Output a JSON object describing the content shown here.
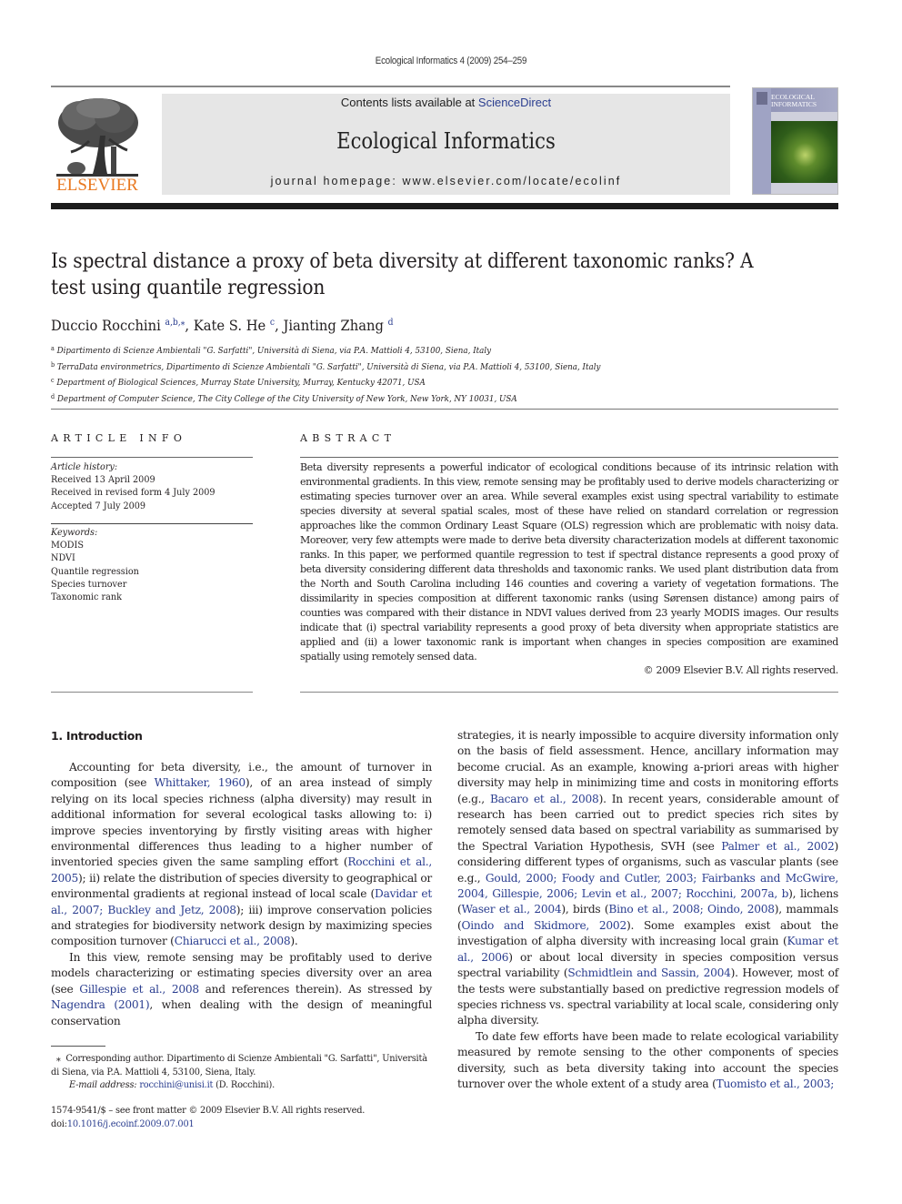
{
  "running_head": "Ecological Informatics 4 (2009) 254–259",
  "masthead": {
    "publisher": "ELSEVIER",
    "contents_prefix": "Contents lists available at ",
    "contents_link": "ScienceDirect",
    "journal_title": "Ecological Informatics",
    "homepage": "journal homepage: www.elsevier.com/locate/ecolinf",
    "cover_title_line1": "ECOLOGICAL",
    "cover_title_line2": "INFORMATICS",
    "colors": {
      "publisher_orange": "#e9781f",
      "link_blue": "#2a3d8f",
      "masthead_gray": "#e6e6e6"
    }
  },
  "article": {
    "title": "Is spectral distance a proxy of beta diversity at different taxonomic ranks? A test using quantile regression",
    "authors": [
      {
        "name": "Duccio Rocchini",
        "sup": "a,b,",
        "star": "⁎",
        "sep": ", "
      },
      {
        "name": "Kate S. He",
        "sup": "c",
        "star": "",
        "sep": ", "
      },
      {
        "name": "Jianting Zhang",
        "sup": "d",
        "star": "",
        "sep": ""
      }
    ],
    "affiliations": [
      {
        "key": "a",
        "text": "Dipartimento di Scienze Ambientali \"G. Sarfatti\", Università di Siena, via P.A. Mattioli 4, 53100, Siena, Italy"
      },
      {
        "key": "b",
        "text": "TerraData environmetrics, Dipartimento di Scienze Ambientali \"G. Sarfatti\", Università di Siena, via P.A. Mattioli 4, 53100, Siena, Italy"
      },
      {
        "key": "c",
        "text": "Department of Biological Sciences, Murray State University, Murray, Kentucky 42071, USA"
      },
      {
        "key": "d",
        "text": "Department of Computer Science, The City College of the City University of New York, New York, NY 10031, USA"
      }
    ]
  },
  "article_info": {
    "heading": "ARTICLE INFO",
    "history_label": "Article history:",
    "history": [
      "Received 13 April 2009",
      "Received in revised form 4 July 2009",
      "Accepted 7 July 2009"
    ],
    "keywords_label": "Keywords:",
    "keywords": [
      "MODIS",
      "NDVI",
      "Quantile regression",
      "Species turnover",
      "Taxonomic rank"
    ]
  },
  "abstract": {
    "heading": "ABSTRACT",
    "text": "Beta diversity represents a powerful indicator of ecological conditions because of its intrinsic relation with environmental gradients. In this view, remote sensing may be profitably used to derive models characterizing or estimating species turnover over an area. While several examples exist using spectral variability to estimate species diversity at several spatial scales, most of these have relied on standard correlation or regression approaches like the common Ordinary Least Square (OLS) regression which are problematic with noisy data. Moreover, very few attempts were made to derive beta diversity characterization models at different taxonomic ranks. In this paper, we performed quantile regression to test if spectral distance represents a good proxy of beta diversity considering different data thresholds and taxonomic ranks. We used plant distribution data from the North and South Carolina including 146 counties and covering a variety of vegetation formations. The dissimilarity in species composition at different taxonomic ranks (using Sørensen distance) among pairs of counties was compared with their distance in NDVI values derived from 23 yearly MODIS images. Our results indicate that (i) spectral variability represents a good proxy of beta diversity when appropriate statistics are applied and (ii) a lower taxonomic rank is important when changes in species composition are examined spatially using remotely sensed data.",
    "copyright": "© 2009 Elsevier B.V. All rights reserved."
  },
  "introduction": {
    "heading": "1. Introduction",
    "left_paragraphs": [
      [
        {
          "t": "Accounting for beta diversity, i.e., the amount of turnover in composition (see "
        },
        {
          "t": "Whittaker, 1960",
          "link": true
        },
        {
          "t": "), of an area instead of simply relying on its local species richness (alpha diversity) may result in additional information for several ecological tasks allowing to: i) improve species inventorying by firstly visiting areas with higher environmental differences thus leading to a higher number of inventoried species given the same sampling effort ("
        },
        {
          "t": "Rocchini et al., 2005",
          "link": true
        },
        {
          "t": "); ii) relate the distribution of species diversity to geographical or environmental gradients at regional instead of local scale ("
        },
        {
          "t": "Davidar et al., 2007; Buckley and Jetz, 2008",
          "link": true
        },
        {
          "t": "); iii) improve conservation policies and strategies for biodiversity network design by maximizing species composition turnover ("
        },
        {
          "t": "Chiarucci et al., 2008",
          "link": true
        },
        {
          "t": ")."
        }
      ],
      [
        {
          "t": "In this view, remote sensing may be profitably used to derive models characterizing or estimating species diversity over an area (see "
        },
        {
          "t": "Gillespie et al., 2008",
          "link": true
        },
        {
          "t": " and references therein). As stressed by "
        },
        {
          "t": "Nagendra (2001)",
          "link": true
        },
        {
          "t": ", when dealing with the design of meaningful conservation"
        }
      ]
    ],
    "right_paragraphs": [
      [
        {
          "t": "strategies, it is nearly impossible to acquire diversity information only on the basis of field assessment. Hence, ancillary information may become crucial. As an example, knowing a-priori areas with higher diversity may help in minimizing time and costs in monitoring efforts (e.g., "
        },
        {
          "t": "Bacaro et al., 2008",
          "link": true
        },
        {
          "t": "). In recent years, considerable amount of research has been carried out to predict species rich sites by remotely sensed data based on spectral variability as summarised by the Spectral Variation Hypothesis, SVH (see "
        },
        {
          "t": "Palmer et al., 2002",
          "link": true
        },
        {
          "t": ") considering different types of organisms, such as vascular plants (see e.g., "
        },
        {
          "t": "Gould, 2000; Foody and Cutler, 2003; Fairbanks and McGwire, 2004, Gillespie, 2006; Levin et al., 2007; Rocchini, 2007a, b",
          "link": true
        },
        {
          "t": "), lichens ("
        },
        {
          "t": "Waser et al., 2004",
          "link": true
        },
        {
          "t": "), birds ("
        },
        {
          "t": "Bino et al., 2008; Oindo, 2008",
          "link": true
        },
        {
          "t": "), mammals ("
        },
        {
          "t": "Oindo and Skidmore, 2002",
          "link": true
        },
        {
          "t": "). Some examples exist about the investigation of alpha diversity with increasing local grain ("
        },
        {
          "t": "Kumar et al., 2006",
          "link": true
        },
        {
          "t": ") or about local diversity in species composition versus spectral variability ("
        },
        {
          "t": "Schmidtlein and Sassin, 2004",
          "link": true
        },
        {
          "t": "). However, most of the tests were substantially based on predictive regression models of species richness vs. spectral variability at local scale, considering only alpha diversity."
        }
      ],
      [
        {
          "t": "To date few efforts have been made to relate ecological variability measured by remote sensing to the other components of species diversity, such as beta diversity taking into account the species turnover over the whole extent of a study area ("
        },
        {
          "t": "Tuomisto et al., 2003;",
          "link": true
        }
      ]
    ]
  },
  "footnote": {
    "star": "⁎",
    "corresponding": "Corresponding author. Dipartimento di Scienze Ambientali \"G. Sarfatti\", Università di Siena, via P.A. Mattioli 4, 53100, Siena, Italy.",
    "email_label": "E-mail address:",
    "email": "rocchini@unisi.it",
    "email_suffix": " (D. Rocchini)."
  },
  "frontmatter": {
    "issn_line": "1574-9541/$ – see front matter © 2009 Elsevier B.V. All rights reserved.",
    "doi_prefix": "doi:",
    "doi": "10.1016/j.ecoinf.2009.07.001"
  }
}
